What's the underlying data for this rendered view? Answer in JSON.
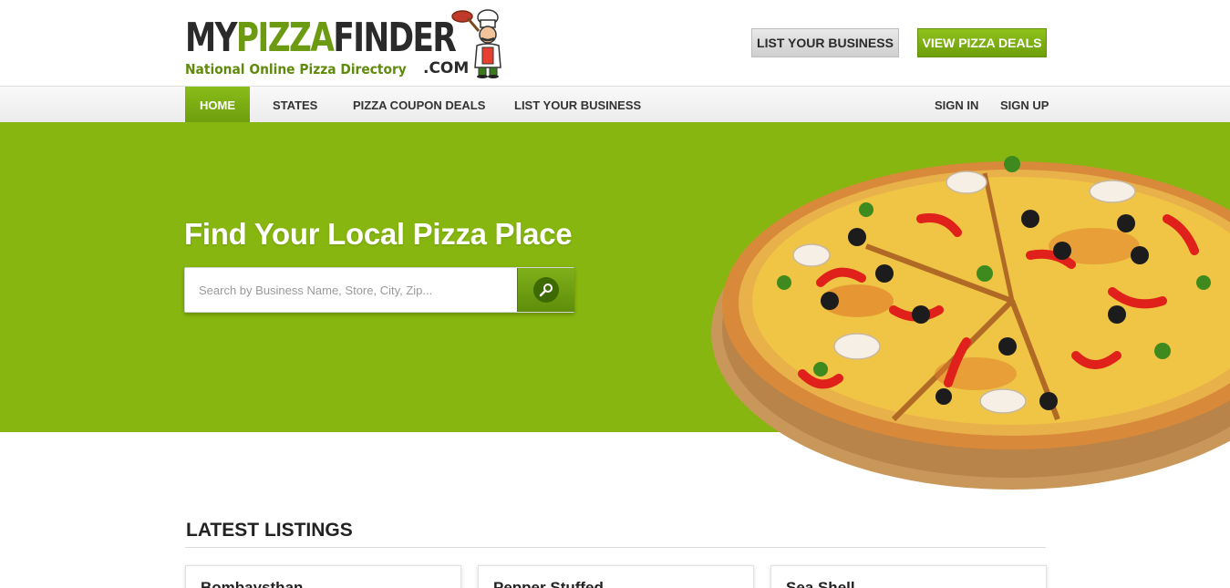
{
  "header": {
    "logo": {
      "word1": "MY",
      "word2": "PIZZA",
      "word3": "FINDER",
      "subtitle": "National Online Pizza Directory",
      "domain_suffix": ".COM"
    },
    "list_business_label": "LIST YOUR BUSINESS",
    "view_deals_label": "VIEW PIZZA DEALS"
  },
  "nav": {
    "items": [
      {
        "label": "HOME",
        "active": true
      },
      {
        "label": "STATES"
      },
      {
        "label": "PIZZA COUPON DEALS"
      },
      {
        "label": "LIST YOUR BUSINESS"
      }
    ],
    "sign_in": "SIGN IN",
    "sign_up": "SIGN UP"
  },
  "hero": {
    "title": "Find Your Local Pizza Place",
    "search_placeholder": "Search by Business Name, Store, City, Zip...",
    "search_icon": "magnifier-icon",
    "background_color": "#86b60f"
  },
  "listings": {
    "heading": "LATEST LISTINGS",
    "cards": [
      {
        "title": "Bombaysthan"
      },
      {
        "title": "Pepper Stuffed"
      },
      {
        "title": "Sea Shell"
      }
    ]
  },
  "colors": {
    "brand_green": "#86b60f",
    "button_gray": "#d9d9d9",
    "text_dark": "#222222"
  }
}
